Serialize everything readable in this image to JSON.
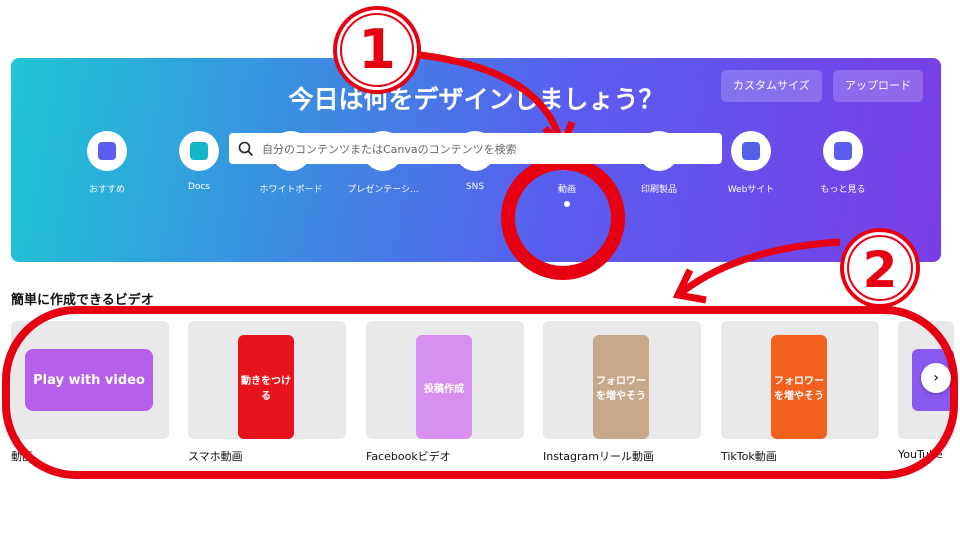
{
  "hero": {
    "title": "今日は何をデザインしましょう？",
    "custom_size": "カスタムサイズ",
    "upload": "アップロード",
    "search_placeholder": "自分のコンテンツまたはCanvaのコンテンツを検索"
  },
  "categories": [
    {
      "label": "おすすめ",
      "icon": "sparkle-icon",
      "color": "#5b5cf0"
    },
    {
      "label": "Docs",
      "icon": "docs-icon",
      "color": "#13b5c8"
    },
    {
      "label": "ホワイトボード",
      "icon": "whiteboard-icon",
      "color": "#1f9a5c"
    },
    {
      "label": "プレゼンテーシ...",
      "icon": "presentation-icon",
      "color": "#f59a0e"
    },
    {
      "label": "SNS",
      "icon": "heart-icon",
      "color": "#ef4a5a"
    },
    {
      "label": "動画",
      "icon": "video-icon",
      "color": "#d060e0",
      "selected": true
    },
    {
      "label": "印刷製品",
      "icon": "printer-icon",
      "color": "#8a4af0"
    },
    {
      "label": "Webサイト",
      "icon": "website-icon",
      "color": "#5460e8"
    },
    {
      "label": "もっと見る",
      "icon": "more-icon",
      "color": "#5b5cf0"
    }
  ],
  "section_title": "簡単に作成できるビデオ",
  "cards": [
    {
      "label": "動画",
      "thumb_text": "Play with video",
      "color": "#b460e8"
    },
    {
      "label": "スマホ動画",
      "thumb_text": "動きをつける",
      "color": "#e8141c"
    },
    {
      "label": "Facebookビデオ",
      "thumb_text": "投稿作成",
      "color": "#d890f0"
    },
    {
      "label": "Instagramリール動画",
      "thumb_text": "フォロワーを増やそう",
      "color": "#c8a88a"
    },
    {
      "label": "TikTok動画",
      "thumb_text": "フォロワーを増やそう",
      "color": "#f2601e"
    },
    {
      "label": "YouTube",
      "thumb_text": "",
      "color": "#8a5af0"
    }
  ],
  "annotations": {
    "step1": "1",
    "step2": "2",
    "color": "#e60012"
  }
}
